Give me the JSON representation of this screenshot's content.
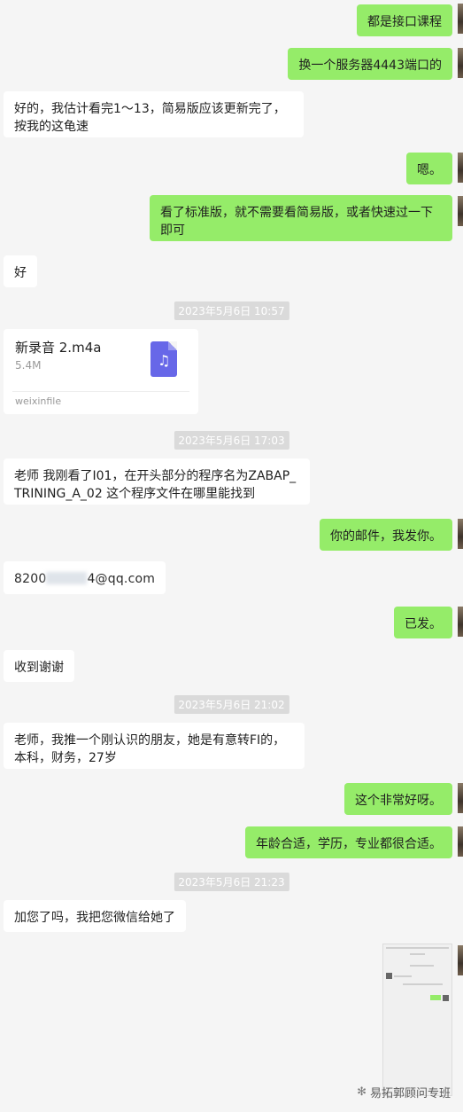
{
  "messages": {
    "m1": "都是接口课程",
    "m2": "换一个服务器4443端口的",
    "m3": "好的，我估计看完1～13，简易版应该更新完了，按我的这龟速",
    "m4": "嗯。",
    "m5": "看了标准版，就不需要看简易版，或者快速过一下即可",
    "m6": "好",
    "m7": "老师 我刚看了I01，在开头部分的程序名为ZABAP_TRINING_A_02  这个程序文件在哪里能找到",
    "m8": "你的邮件，我发你。",
    "m9_prefix": "8200",
    "m9_suffix": "4@qq.com",
    "m10": "已发。",
    "m11": "收到谢谢",
    "m12": "老师，我推一个刚认识的朋友，她是有意转FI的，本科，财务，27岁",
    "m13": "这个非常好呀。",
    "m14": "年龄合适，学历，专业都很合适。",
    "m15": "加您了吗，我把您微信给她了"
  },
  "timestamps": {
    "t1": "2023年5月6日 10:57",
    "t2": "2023年5月6日 17:03",
    "t3": "2023年5月6日 21:02",
    "t4": "2023年5月6日 21:23"
  },
  "file": {
    "name": "新录音 2.m4a",
    "size": "5.4M",
    "source": "weixinfile",
    "icon": "audio-file-icon"
  },
  "watermark": {
    "text": "易拓郭顾问专班",
    "icon": "wechat-official-icon"
  },
  "colors": {
    "outgoing_bubble": "#95ec69",
    "incoming_bubble": "#ffffff",
    "background": "#f5f5f5",
    "audio_icon": "#6767e8"
  }
}
